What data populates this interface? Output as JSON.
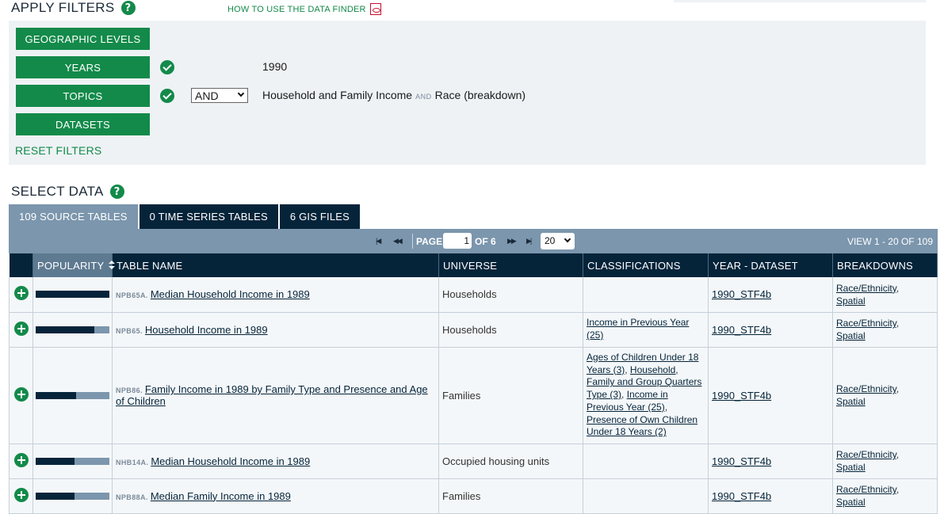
{
  "filters": {
    "title": "APPLY FILTERS",
    "help": "?",
    "howto": "HOW TO USE THE DATA FINDER",
    "buttons": {
      "geo": "GEOGRAPHIC LEVELS",
      "years": "YEARS",
      "topics": "TOPICS",
      "datasets": "DATASETS"
    },
    "years_value": "1990",
    "topic_operator": "AND",
    "topic_1": "Household and Family Income",
    "topic_join": "AND",
    "topic_2": "Race (breakdown)",
    "reset": "RESET FILTERS"
  },
  "select": {
    "title": "SELECT DATA",
    "help": "?",
    "tabs": [
      "109 SOURCE TABLES",
      "0 TIME SERIES TABLES",
      "6 GIS FILES"
    ]
  },
  "pager": {
    "page_label": "PAGE",
    "page": "1",
    "of_label": "OF 6",
    "per_page": "20",
    "view": "VIEW 1 - 20 OF 109"
  },
  "table": {
    "headers": {
      "popularity": "POPULARITY",
      "name": "TABLE NAME",
      "universe": "UNIVERSE",
      "classifications": "CLASSIFICATIONS",
      "year": "YEAR - DATASET",
      "breakdowns": "BREAKDOWNS"
    },
    "rows": [
      {
        "popularity": 1.0,
        "code": "NPB65A.",
        "name": "Median Household Income in 1989",
        "universe": "Households",
        "classifications": "",
        "year": "1990_STF4b",
        "breakdown_1": "Race/Ethnicity",
        "breakdown_sep": ",",
        "breakdown_2": "Spatial"
      },
      {
        "popularity": 0.8,
        "code": "NPB65.",
        "name": "Household Income in 1989",
        "universe": "Households",
        "classifications": "Income in Previous Year (25)",
        "year": "1990_STF4b",
        "breakdown_1": "Race/Ethnicity",
        "breakdown_sep": ",",
        "breakdown_2": "Spatial"
      },
      {
        "popularity": 0.55,
        "code": "NPB86.",
        "name": "Family Income in 1989 by Family Type and Presence and Age of Children",
        "universe": "Families",
        "classifications": "",
        "cls_links": [
          "Ages of Children Under 18 Years (3)",
          "Household, Family and Group Quarters Type (3)",
          "Income in Previous Year (25)",
          "Presence of Own Children Under 18 Years (2)"
        ],
        "cls_sep": ", ",
        "year": "1990_STF4b",
        "breakdown_1": "Race/Ethnicity",
        "breakdown_sep": ",",
        "breakdown_2": "Spatial"
      },
      {
        "popularity": 0.53,
        "code": "NHB14A.",
        "name": "Median Household Income in 1989",
        "universe": "Occupied housing units",
        "classifications": "",
        "year": "1990_STF4b",
        "breakdown_1": "Race/Ethnicity",
        "breakdown_sep": ",",
        "breakdown_2": "Spatial"
      },
      {
        "popularity": 0.53,
        "code": "NPB88A.",
        "name": "Median Family Income in 1989",
        "universe": "Families",
        "classifications": "",
        "year": "1990_STF4b",
        "breakdown_1": "Race/Ethnicity",
        "breakdown_sep": ",",
        "breakdown_2": "Spatial"
      }
    ]
  },
  "colors": {
    "green": "#138a4a",
    "navy": "#05243a",
    "slate": "#7b96ad",
    "panel": "#eef2f5"
  },
  "icons": [
    "help-icon",
    "pdf-icon",
    "check-icon",
    "plus-icon",
    "first-page-icon",
    "prev-page-icon",
    "next-page-icon",
    "last-page-icon",
    "sort-icon"
  ]
}
